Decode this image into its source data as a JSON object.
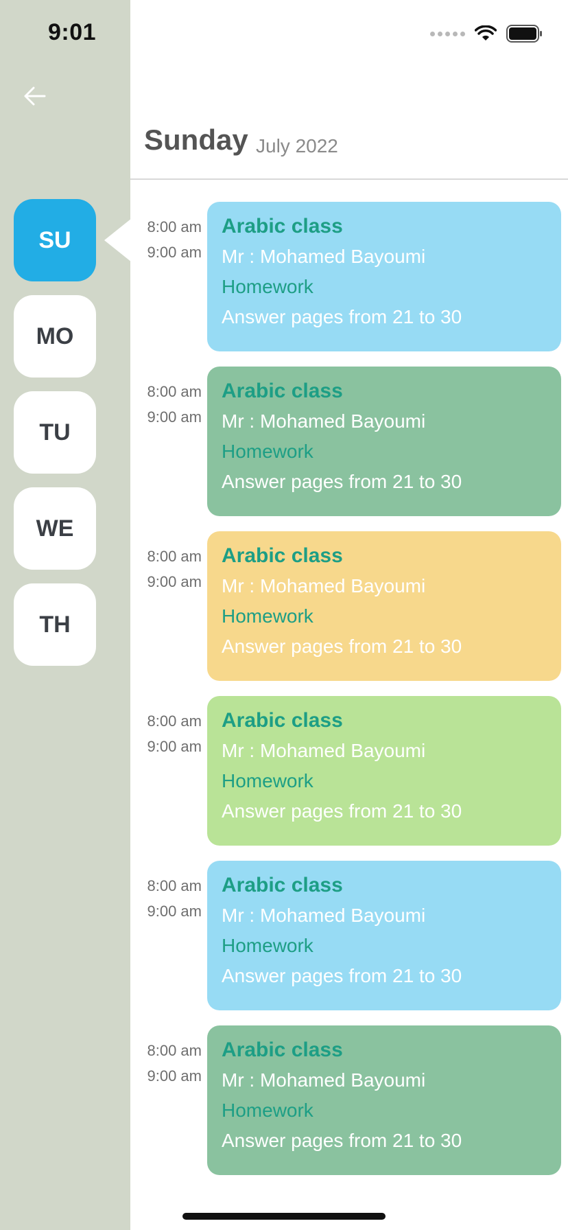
{
  "status_bar": {
    "time": "9:01"
  },
  "header": {
    "day": "Sunday",
    "month": "July 2022"
  },
  "days": [
    {
      "label": "SU",
      "active": true
    },
    {
      "label": "MO",
      "active": false
    },
    {
      "label": "TU",
      "active": false
    },
    {
      "label": "WE",
      "active": false
    },
    {
      "label": "TH",
      "active": false
    }
  ],
  "classes": [
    {
      "start": "8:00 am",
      "end": "9:00 am",
      "subject": "Arabic class",
      "teacher": "Mr : Mohamed Bayoumi",
      "homework_label": "Homework",
      "homework": "Answer pages from 21 to 30",
      "color": "#97dbf4"
    },
    {
      "start": "8:00 am",
      "end": "9:00 am",
      "subject": "Arabic class",
      "teacher": "Mr : Mohamed Bayoumi",
      "homework_label": "Homework",
      "homework": "Answer pages from 21 to 30",
      "color": "#8ac29f"
    },
    {
      "start": "8:00 am",
      "end": "9:00 am",
      "subject": "Arabic class",
      "teacher": "Mr : Mohamed Bayoumi",
      "homework_label": "Homework",
      "homework": "Answer pages from 21 to 30",
      "color": "#f7d88c"
    },
    {
      "start": "8:00 am",
      "end": "9:00 am",
      "subject": "Arabic class",
      "teacher": "Mr : Mohamed Bayoumi",
      "homework_label": "Homework",
      "homework": "Answer pages from 21 to 30",
      "color": "#b9e397"
    },
    {
      "start": "8:00 am",
      "end": "9:00 am",
      "subject": "Arabic class",
      "teacher": "Mr : Mohamed Bayoumi",
      "homework_label": "Homework",
      "homework": "Answer pages from 21 to 30",
      "color": "#97dbf4"
    },
    {
      "start": "8:00 am",
      "end": "9:00 am",
      "subject": "Arabic class",
      "teacher": "Mr : Mohamed Bayoumi",
      "homework_label": "Homework",
      "homework": "Answer pages from 21 to 30",
      "color": "#8ac29f"
    }
  ]
}
